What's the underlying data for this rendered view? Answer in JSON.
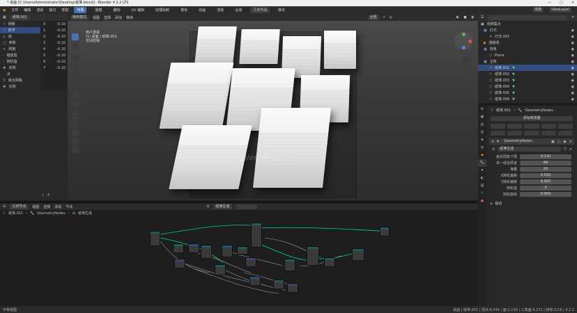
{
  "titlebar": {
    "title": "* 桌面 [C:\\Users\\Administrator\\Desktop\\纸堆.blend] - Blender 4.2.2 LTS"
  },
  "menubar": {
    "items": [
      "文件",
      "编辑",
      "渲染",
      "窗口",
      "帮助"
    ],
    "workspaces": [
      "布局",
      "建模",
      "雕刻",
      "UV 编辑",
      "纹理绘制",
      "着色",
      "动画",
      "渲染",
      "合成",
      "几何节点",
      "脚本"
    ],
    "active_workspace": "布局",
    "scene": "场景",
    "view_layer": "ViewLayer"
  },
  "left_panel": {
    "header": {
      "object": "纸堆.001"
    },
    "items": [
      {
        "label": "刷新",
        "selected": false
      },
      {
        "label": "数学",
        "selected": true
      },
      {
        "label": "值",
        "selected": false
      },
      {
        "label": "参数",
        "selected": false
      },
      {
        "label": "网格",
        "selected": false
      },
      {
        "label": "缩放值",
        "selected": false
      },
      {
        "label": "随机值",
        "selected": false
      },
      {
        "label": "实例",
        "selected": false
      },
      {
        "label": "点",
        "selected": false
      },
      {
        "label": "组合网格",
        "selected": false
      },
      {
        "label": "实例",
        "selected": false
      }
    ],
    "values": [
      "-0.10",
      "-0.10",
      "-0.10",
      "-0.10",
      "-0.10",
      "-0.10",
      "-0.10",
      "-0.10"
    ],
    "indices": [
      "0",
      "1",
      "2",
      "3",
      "4",
      "5",
      "6",
      "7"
    ],
    "footer": "1 : 8"
  },
  "viewport": {
    "header": [
      "物体模式",
      "视图",
      "选择",
      "添加",
      "物体"
    ],
    "transform": "全局",
    "overlay_text": [
      "用户透视",
      "(1) 桌面 | 纸堆.001",
      "空间剪辑"
    ],
    "watermark": "Blendercg.cn"
  },
  "outliner": {
    "title": "场景集合",
    "items": [
      {
        "label": "灯光",
        "type": "collection"
      },
      {
        "label": "灯光.001",
        "type": "light"
      },
      {
        "label": "摄像机",
        "type": "camera"
      },
      {
        "label": "背景",
        "type": "collection"
      },
      {
        "label": "Plane",
        "type": "mesh"
      },
      {
        "label": "主体",
        "type": "collection"
      },
      {
        "label": "纸堆.001",
        "type": "mesh"
      },
      {
        "label": "纸堆.002",
        "type": "mesh"
      },
      {
        "label": "纸堆.003",
        "type": "mesh"
      },
      {
        "label": "纸堆.004",
        "type": "mesh"
      },
      {
        "label": "纸堆.005",
        "type": "mesh"
      },
      {
        "label": "纸堆.006",
        "type": "mesh"
      }
    ]
  },
  "properties": {
    "breadcrumb": [
      "纸堆.001",
      "GeometryNodes"
    ],
    "add_modifier": "添加修改器",
    "modifier_name": "GeometryNodes",
    "group": "纸堆生成",
    "fields": [
      {
        "label": "纸张层数下限",
        "value": "0.110"
      },
      {
        "label": "单一纸张厚度",
        "value": "64"
      },
      {
        "label": "堆叠",
        "value": "20"
      },
      {
        "label": "X随机偏移",
        "value": "0.010"
      },
      {
        "label": "Y随机偏移",
        "value": "0.003"
      },
      {
        "label": "随机值",
        "value": "3"
      },
      {
        "label": "随机旋转",
        "value": "0.003"
      }
    ],
    "footer": "输出"
  },
  "node_editor": {
    "header": [
      "几何节点",
      "视图",
      "选择",
      "添加",
      "节点"
    ],
    "breadcrumb": [
      "纸堆.001",
      "GeometryNodes",
      "纸堆生成"
    ],
    "node_group": "纸堆生成"
  },
  "statusbar": {
    "left": "平移视图",
    "right": "桌面 | 纸堆.001 | 顶点:8,544 | 面:2,136 | 三角面:4,272 | 物体:1/16 | 4.2.2"
  },
  "colors": {
    "accent": "#4772b3",
    "node_link": "#00d6a3"
  }
}
